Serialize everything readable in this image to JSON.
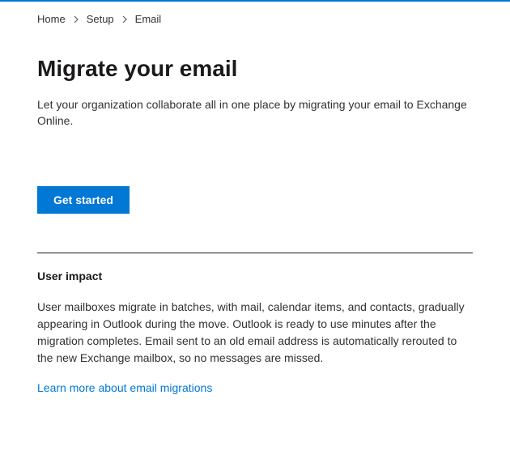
{
  "breadcrumb": {
    "home": "Home",
    "setup": "Setup",
    "email": "Email"
  },
  "header": {
    "title": "Migrate your email",
    "description": "Let your organization collaborate all in one place by migrating your email to Exchange Online."
  },
  "actions": {
    "get_started": "Get started"
  },
  "section": {
    "title": "User impact",
    "body": "User mailboxes migrate in batches, with mail, calendar items, and contacts, gradually appearing in Outlook during the move. Outlook is ready to use minutes after the migration completes. Email sent to an old email address is automatically rerouted to the new Exchange mailbox, so no messages are missed.",
    "link": "Learn more about email migrations"
  }
}
